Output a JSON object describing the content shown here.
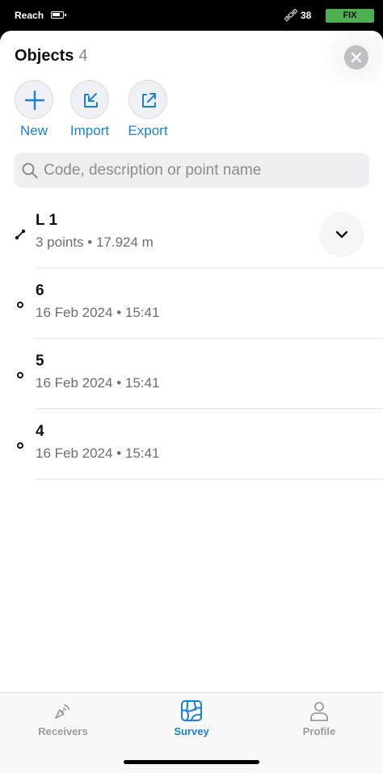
{
  "status_bar": {
    "app_name": "Reach",
    "satellite_count": "38",
    "fix_status": "FIX",
    "fix_color": "#4caf50",
    "icons": [
      "battery-icon",
      "satellite-icon"
    ]
  },
  "header": {
    "title": "Objects",
    "count": "4"
  },
  "actions": [
    {
      "label": "New",
      "icon": "plus-icon"
    },
    {
      "label": "Import",
      "icon": "import-icon"
    },
    {
      "label": "Export",
      "icon": "export-icon"
    }
  ],
  "search": {
    "placeholder": "Code, description or point name",
    "value": ""
  },
  "objects": [
    {
      "name": "L 1",
      "detail": "3 points • 17.924 m",
      "type": "line"
    },
    {
      "name": "6",
      "detail": "16 Feb 2024 • 15:41",
      "type": "point"
    },
    {
      "name": "5",
      "detail": "16 Feb 2024 • 15:41",
      "type": "point"
    },
    {
      "name": "4",
      "detail": "16 Feb 2024 • 15:41",
      "type": "point"
    }
  ],
  "tabs": [
    {
      "label": "Receivers",
      "icon": "receivers-icon",
      "active": false
    },
    {
      "label": "Survey",
      "icon": "survey-map-icon",
      "active": true
    },
    {
      "label": "Profile",
      "icon": "profile-icon",
      "active": false
    }
  ],
  "colors": {
    "accent": "#1a7fd6",
    "fix": "#4caf50"
  }
}
